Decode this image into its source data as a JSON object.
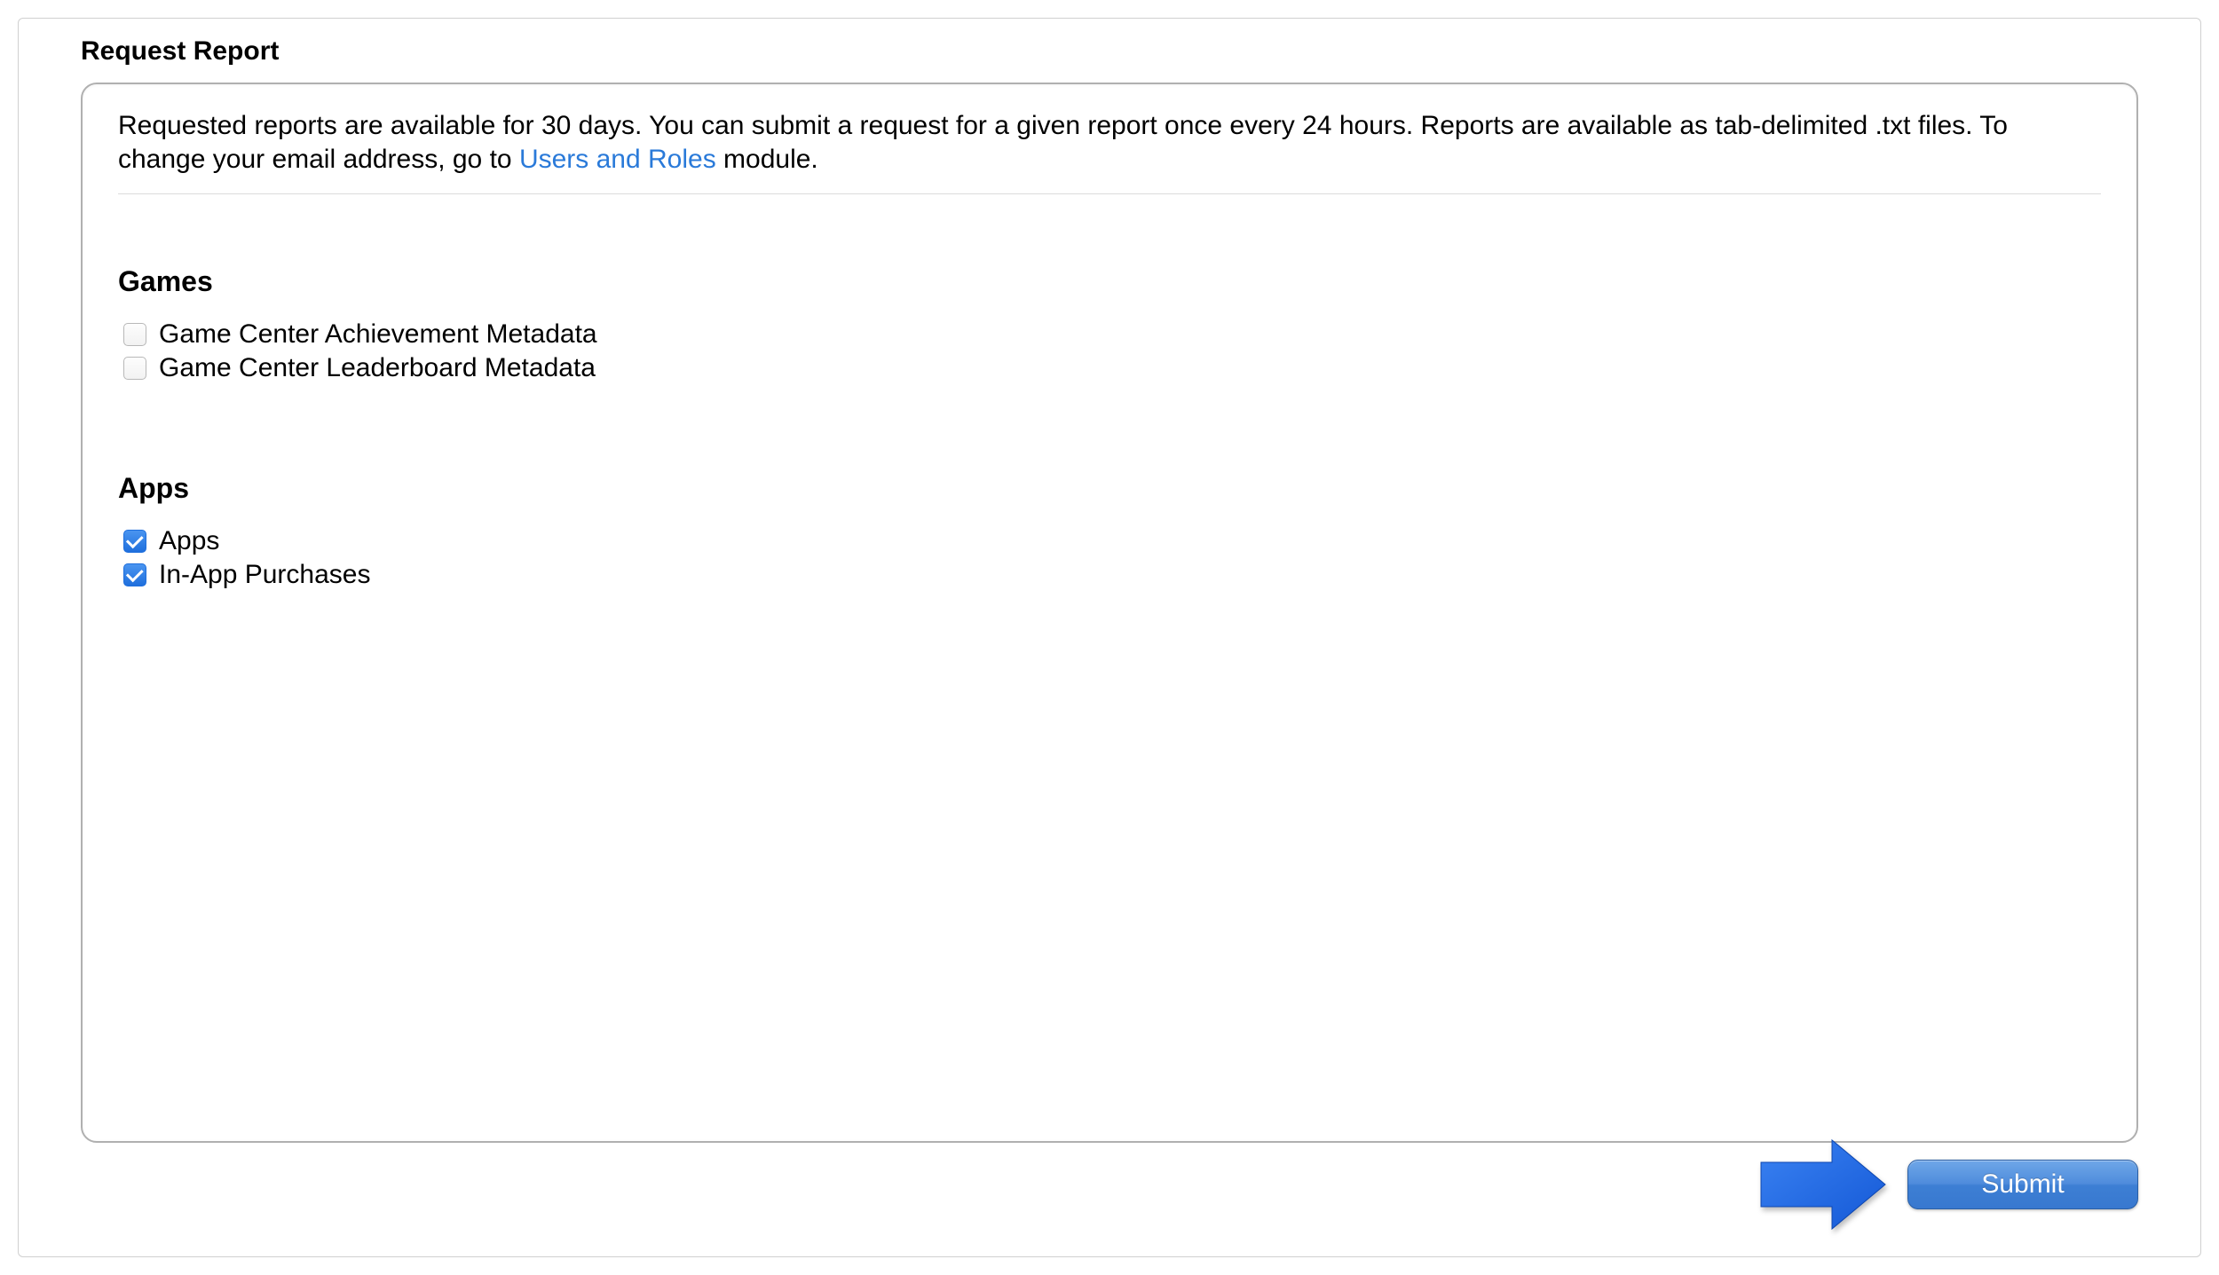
{
  "page_title": "Request Report",
  "description": {
    "text_before_link": "Requested reports are available for 30 days. You can submit a request for a given report once every 24 hours. Reports are available as tab-delimited .txt files. To change your email address, go to ",
    "link_text": "Users and Roles",
    "text_after_link": " module."
  },
  "sections": [
    {
      "heading": "Games",
      "items": [
        {
          "label": "Game Center Achievement Metadata",
          "checked": false
        },
        {
          "label": "Game Center Leaderboard Metadata",
          "checked": false
        }
      ]
    },
    {
      "heading": "Apps",
      "items": [
        {
          "label": "Apps",
          "checked": true
        },
        {
          "label": "In-App Purchases",
          "checked": true
        }
      ]
    }
  ],
  "submit_label": "Submit"
}
